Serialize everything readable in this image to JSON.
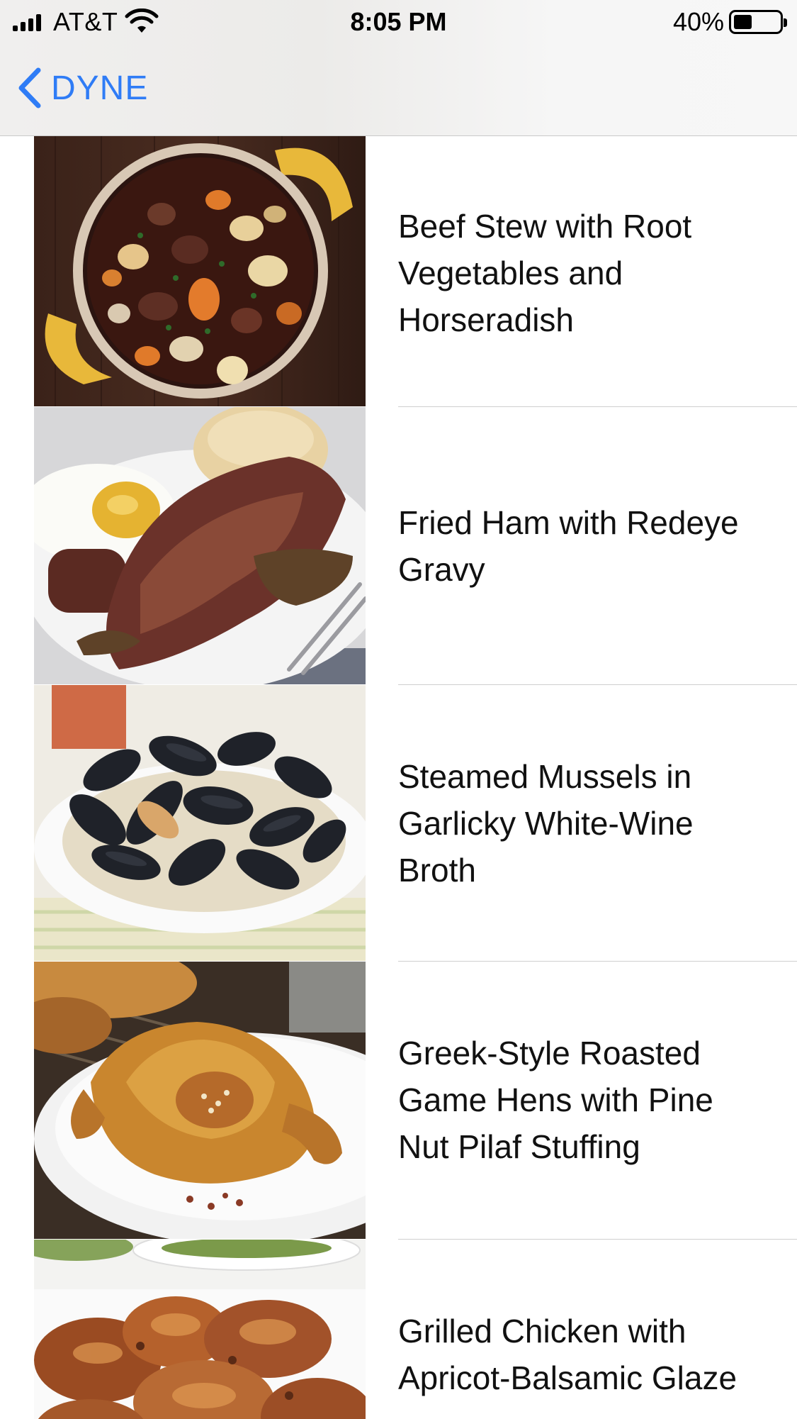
{
  "status_bar": {
    "carrier": "AT&T",
    "time": "8:05 PM",
    "battery_percent": "40%",
    "battery_level": 0.4,
    "signal_bars": 4,
    "wifi_icon": "wifi-icon"
  },
  "nav": {
    "back_label": "DYNE",
    "back_icon": "chevron-left-icon",
    "accent_color": "#2f7cf6"
  },
  "recipes": [
    {
      "title": "Beef Stew with Root Vegetables and Horseradish",
      "image": "beef-stew-photo"
    },
    {
      "title": "Fried Ham with Redeye Gravy",
      "image": "fried-ham-photo"
    },
    {
      "title": "Steamed Mussels in Garlicky White-Wine Broth",
      "image": "steamed-mussels-photo"
    },
    {
      "title": "Greek-Style Roasted Game Hens with Pine Nut Pilaf Stuffing",
      "image": "game-hens-photo"
    },
    {
      "title": "Grilled Chicken with Apricot-Balsamic Glaze",
      "image": "grilled-chicken-photo"
    }
  ]
}
